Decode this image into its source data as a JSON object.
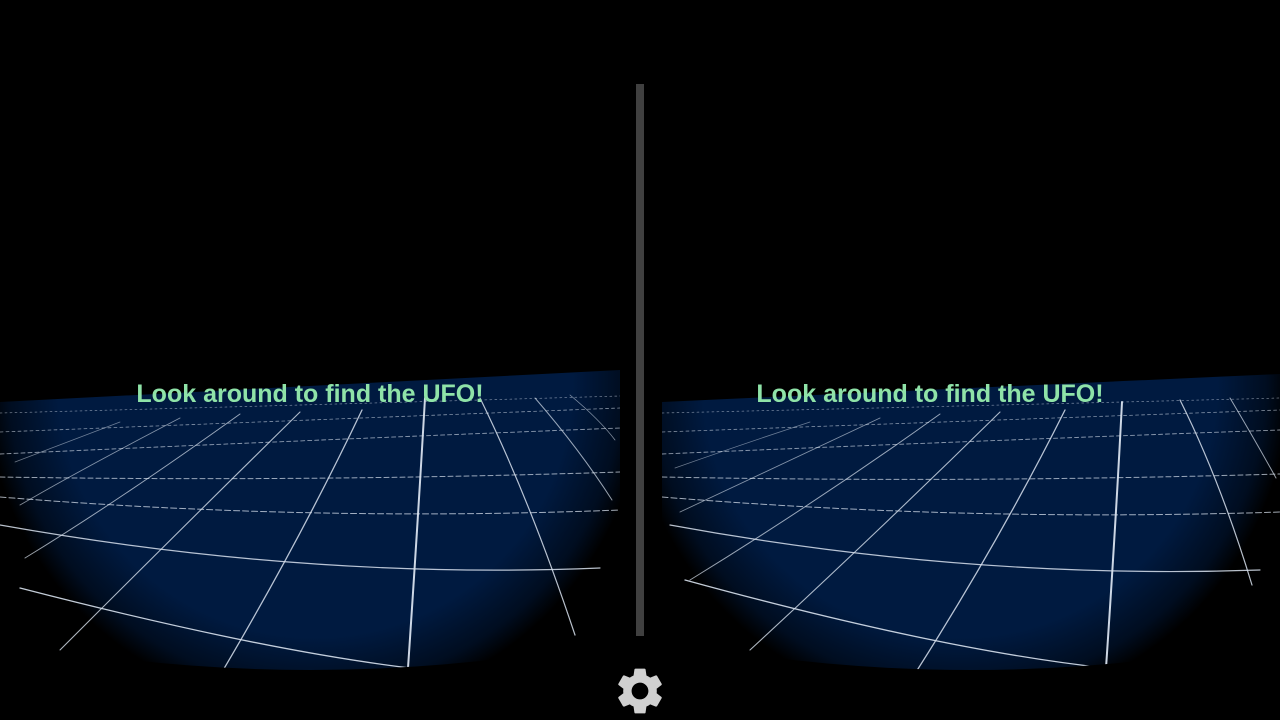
{
  "left_eye": {
    "message": "Look around to find the UFO!"
  },
  "right_eye": {
    "message": "Look around to find the UFO!"
  },
  "colors": {
    "background": "#000000",
    "floor": "#001a40",
    "grid_lines": "#d8e2ee",
    "message_text": "#8fe3a8",
    "divider": "#404040",
    "settings_icon": "#d0d0d0"
  },
  "icons": {
    "settings": "gear-icon"
  }
}
